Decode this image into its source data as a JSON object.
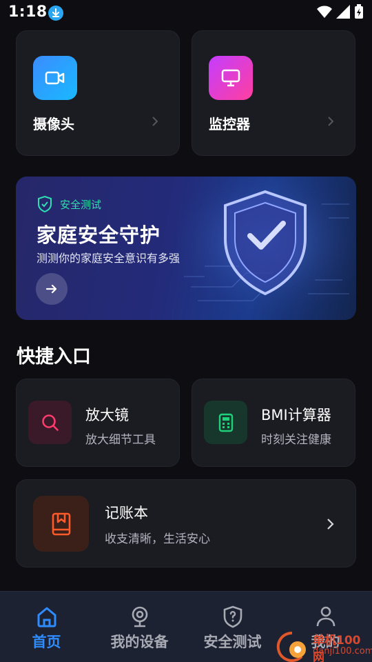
{
  "status_bar": {
    "time": "1:18",
    "icons": [
      "download-icon",
      "wifi-icon",
      "signal-icon",
      "battery-charging-icon"
    ]
  },
  "devices": [
    {
      "label": "摄像头",
      "icon": "video-camera-icon"
    },
    {
      "label": "监控器",
      "icon": "monitor-icon"
    }
  ],
  "banner": {
    "tag": "安全测试",
    "title": "家庭安全守护",
    "subtitle": "测测你的家庭安全意识有多强",
    "icons": [
      "shield-check-icon",
      "arrow-right-icon"
    ]
  },
  "quick_entry": {
    "title": "快捷入口",
    "items": [
      {
        "title": "放大镜",
        "subtitle": "放大细节工具",
        "icon": "magnifier-icon",
        "color": "#ff3b6b"
      },
      {
        "title": "BMI计算器",
        "subtitle": "时刻关注健康",
        "icon": "calculator-icon",
        "color": "#1fd17a"
      }
    ],
    "ledger": {
      "title": "记账本",
      "subtitle": "收支清晰，生活安心",
      "icon": "book-icon",
      "color": "#ff5a2a"
    }
  },
  "bottom_nav": [
    {
      "label": "首页",
      "icon": "home-icon",
      "active": true
    },
    {
      "label": "我的设备",
      "icon": "webcam-icon",
      "active": false
    },
    {
      "label": "安全测试",
      "icon": "shield-question-icon",
      "active": false
    },
    {
      "label": "我的",
      "icon": "person-icon",
      "active": false
    }
  ],
  "watermark": {
    "text": "单机100网",
    "url": "danji100.com"
  },
  "colors": {
    "background": "#0d0d12",
    "card": "#1b1b22",
    "accent": "#2f8cff",
    "banner_tag": "#2ee0b0"
  }
}
